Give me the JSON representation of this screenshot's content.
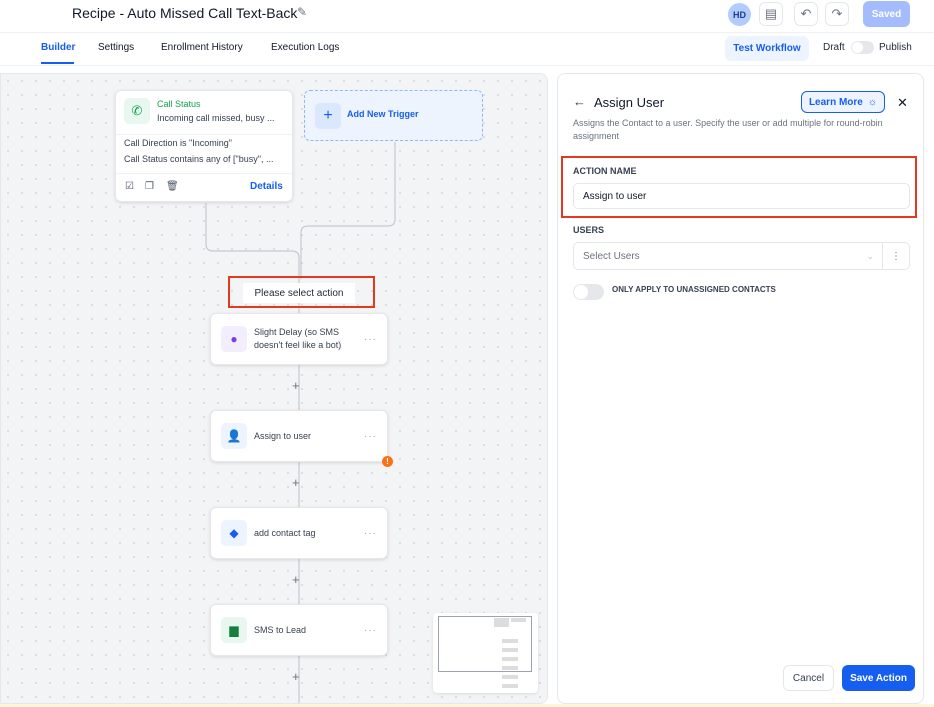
{
  "header": {
    "title": "Recipe - Auto Missed Call Text-Back",
    "avatar": "HD",
    "saved_label": "Saved"
  },
  "tabs": [
    {
      "label": "Builder"
    },
    {
      "label": "Settings"
    },
    {
      "label": "Enrollment History"
    },
    {
      "label": "Execution Logs"
    }
  ],
  "toolbar": {
    "test_workflow": "Test Workflow",
    "draft": "Draft",
    "publish": "Publish"
  },
  "trigger": {
    "title": "Call Status",
    "subtitle": "Incoming call missed, busy ...",
    "conditions": [
      "Call Direction is \"Incoming\"",
      "Call Status contains any of [\"busy\", ..."
    ],
    "details": "Details"
  },
  "add_trigger": "Add New Trigger",
  "select_action": "Please select action",
  "actions": [
    {
      "label": "Slight Delay (so SMS doesn't feel like a bot)"
    },
    {
      "label": "Assign to user"
    },
    {
      "label": "add contact tag"
    },
    {
      "label": "SMS to Lead"
    }
  ],
  "panel": {
    "title": "Assign User",
    "learn_more": "Learn More",
    "description": "Assigns the Contact to a user. Specify the user or add multiple for round-robin assignment",
    "action_name_label": "ACTION NAME",
    "action_name_value": "Assign to user",
    "users_label": "USERS",
    "users_placeholder": "Select Users",
    "toggle_label": "ONLY APPLY TO UNASSIGNED CONTACTS",
    "cancel": "Cancel",
    "save": "Save Action"
  },
  "colors": {
    "accent": "#155eef",
    "highlight": "#e5391f",
    "warning": "#f97316"
  }
}
